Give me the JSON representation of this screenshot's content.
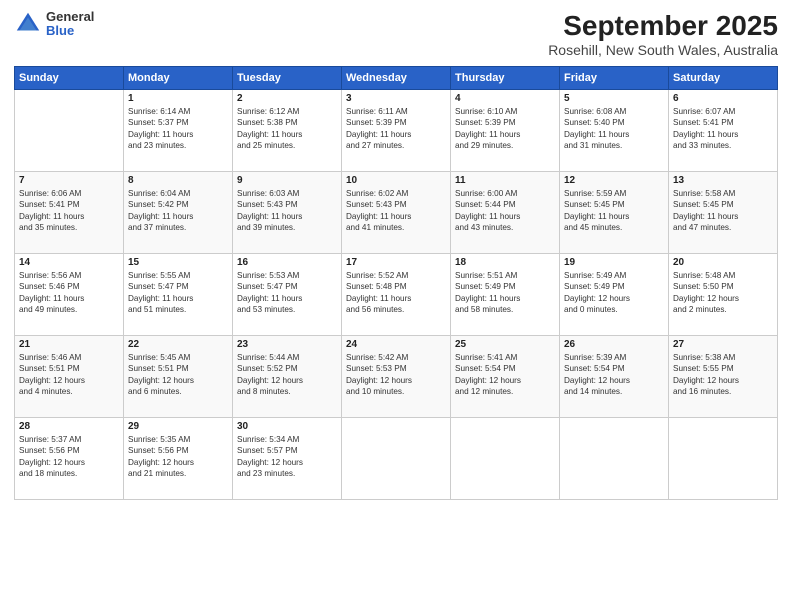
{
  "logo": {
    "general": "General",
    "blue": "Blue"
  },
  "header": {
    "month_year": "September 2025",
    "location": "Rosehill, New South Wales, Australia"
  },
  "days_of_week": [
    "Sunday",
    "Monday",
    "Tuesday",
    "Wednesday",
    "Thursday",
    "Friday",
    "Saturday"
  ],
  "weeks": [
    [
      {
        "day": "",
        "content": ""
      },
      {
        "day": "1",
        "content": "Sunrise: 6:14 AM\nSunset: 5:37 PM\nDaylight: 11 hours\nand 23 minutes."
      },
      {
        "day": "2",
        "content": "Sunrise: 6:12 AM\nSunset: 5:38 PM\nDaylight: 11 hours\nand 25 minutes."
      },
      {
        "day": "3",
        "content": "Sunrise: 6:11 AM\nSunset: 5:39 PM\nDaylight: 11 hours\nand 27 minutes."
      },
      {
        "day": "4",
        "content": "Sunrise: 6:10 AM\nSunset: 5:39 PM\nDaylight: 11 hours\nand 29 minutes."
      },
      {
        "day": "5",
        "content": "Sunrise: 6:08 AM\nSunset: 5:40 PM\nDaylight: 11 hours\nand 31 minutes."
      },
      {
        "day": "6",
        "content": "Sunrise: 6:07 AM\nSunset: 5:41 PM\nDaylight: 11 hours\nand 33 minutes."
      }
    ],
    [
      {
        "day": "7",
        "content": "Sunrise: 6:06 AM\nSunset: 5:41 PM\nDaylight: 11 hours\nand 35 minutes."
      },
      {
        "day": "8",
        "content": "Sunrise: 6:04 AM\nSunset: 5:42 PM\nDaylight: 11 hours\nand 37 minutes."
      },
      {
        "day": "9",
        "content": "Sunrise: 6:03 AM\nSunset: 5:43 PM\nDaylight: 11 hours\nand 39 minutes."
      },
      {
        "day": "10",
        "content": "Sunrise: 6:02 AM\nSunset: 5:43 PM\nDaylight: 11 hours\nand 41 minutes."
      },
      {
        "day": "11",
        "content": "Sunrise: 6:00 AM\nSunset: 5:44 PM\nDaylight: 11 hours\nand 43 minutes."
      },
      {
        "day": "12",
        "content": "Sunrise: 5:59 AM\nSunset: 5:45 PM\nDaylight: 11 hours\nand 45 minutes."
      },
      {
        "day": "13",
        "content": "Sunrise: 5:58 AM\nSunset: 5:45 PM\nDaylight: 11 hours\nand 47 minutes."
      }
    ],
    [
      {
        "day": "14",
        "content": "Sunrise: 5:56 AM\nSunset: 5:46 PM\nDaylight: 11 hours\nand 49 minutes."
      },
      {
        "day": "15",
        "content": "Sunrise: 5:55 AM\nSunset: 5:47 PM\nDaylight: 11 hours\nand 51 minutes."
      },
      {
        "day": "16",
        "content": "Sunrise: 5:53 AM\nSunset: 5:47 PM\nDaylight: 11 hours\nand 53 minutes."
      },
      {
        "day": "17",
        "content": "Sunrise: 5:52 AM\nSunset: 5:48 PM\nDaylight: 11 hours\nand 56 minutes."
      },
      {
        "day": "18",
        "content": "Sunrise: 5:51 AM\nSunset: 5:49 PM\nDaylight: 11 hours\nand 58 minutes."
      },
      {
        "day": "19",
        "content": "Sunrise: 5:49 AM\nSunset: 5:49 PM\nDaylight: 12 hours\nand 0 minutes."
      },
      {
        "day": "20",
        "content": "Sunrise: 5:48 AM\nSunset: 5:50 PM\nDaylight: 12 hours\nand 2 minutes."
      }
    ],
    [
      {
        "day": "21",
        "content": "Sunrise: 5:46 AM\nSunset: 5:51 PM\nDaylight: 12 hours\nand 4 minutes."
      },
      {
        "day": "22",
        "content": "Sunrise: 5:45 AM\nSunset: 5:51 PM\nDaylight: 12 hours\nand 6 minutes."
      },
      {
        "day": "23",
        "content": "Sunrise: 5:44 AM\nSunset: 5:52 PM\nDaylight: 12 hours\nand 8 minutes."
      },
      {
        "day": "24",
        "content": "Sunrise: 5:42 AM\nSunset: 5:53 PM\nDaylight: 12 hours\nand 10 minutes."
      },
      {
        "day": "25",
        "content": "Sunrise: 5:41 AM\nSunset: 5:54 PM\nDaylight: 12 hours\nand 12 minutes."
      },
      {
        "day": "26",
        "content": "Sunrise: 5:39 AM\nSunset: 5:54 PM\nDaylight: 12 hours\nand 14 minutes."
      },
      {
        "day": "27",
        "content": "Sunrise: 5:38 AM\nSunset: 5:55 PM\nDaylight: 12 hours\nand 16 minutes."
      }
    ],
    [
      {
        "day": "28",
        "content": "Sunrise: 5:37 AM\nSunset: 5:56 PM\nDaylight: 12 hours\nand 18 minutes."
      },
      {
        "day": "29",
        "content": "Sunrise: 5:35 AM\nSunset: 5:56 PM\nDaylight: 12 hours\nand 21 minutes."
      },
      {
        "day": "30",
        "content": "Sunrise: 5:34 AM\nSunset: 5:57 PM\nDaylight: 12 hours\nand 23 minutes."
      },
      {
        "day": "",
        "content": ""
      },
      {
        "day": "",
        "content": ""
      },
      {
        "day": "",
        "content": ""
      },
      {
        "day": "",
        "content": ""
      }
    ]
  ]
}
